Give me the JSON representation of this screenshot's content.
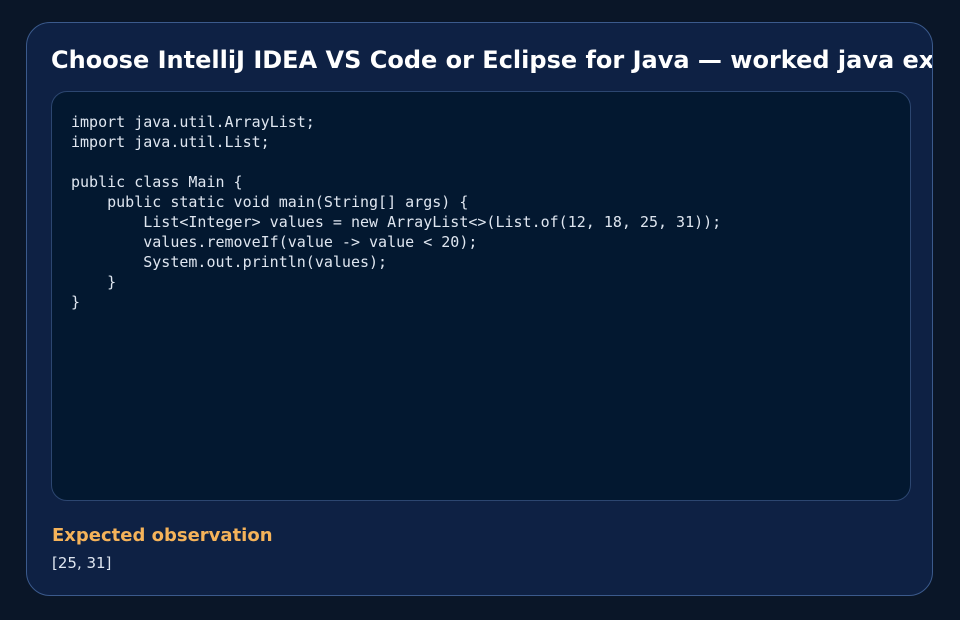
{
  "card": {
    "title": "Choose IntelliJ IDEA VS Code or Eclipse for Java — worked java example"
  },
  "code": {
    "lines": [
      "import java.util.ArrayList;",
      "import java.util.List;",
      "",
      "public class Main {",
      "    public static void main(String[] args) {",
      "        List<Integer> values = new ArrayList<>(List.of(12, 18, 25, 31));",
      "        values.removeIf(value -> value < 20);",
      "        System.out.println(values);",
      "    }",
      "}"
    ]
  },
  "observation": {
    "heading": "Expected observation",
    "value": "[25, 31]"
  },
  "colors": {
    "page_background": "#0a1628",
    "card_background": "#0e2144",
    "code_background": "#031830",
    "heading_accent": "#f5b35a",
    "text": "#dfe6f0"
  }
}
